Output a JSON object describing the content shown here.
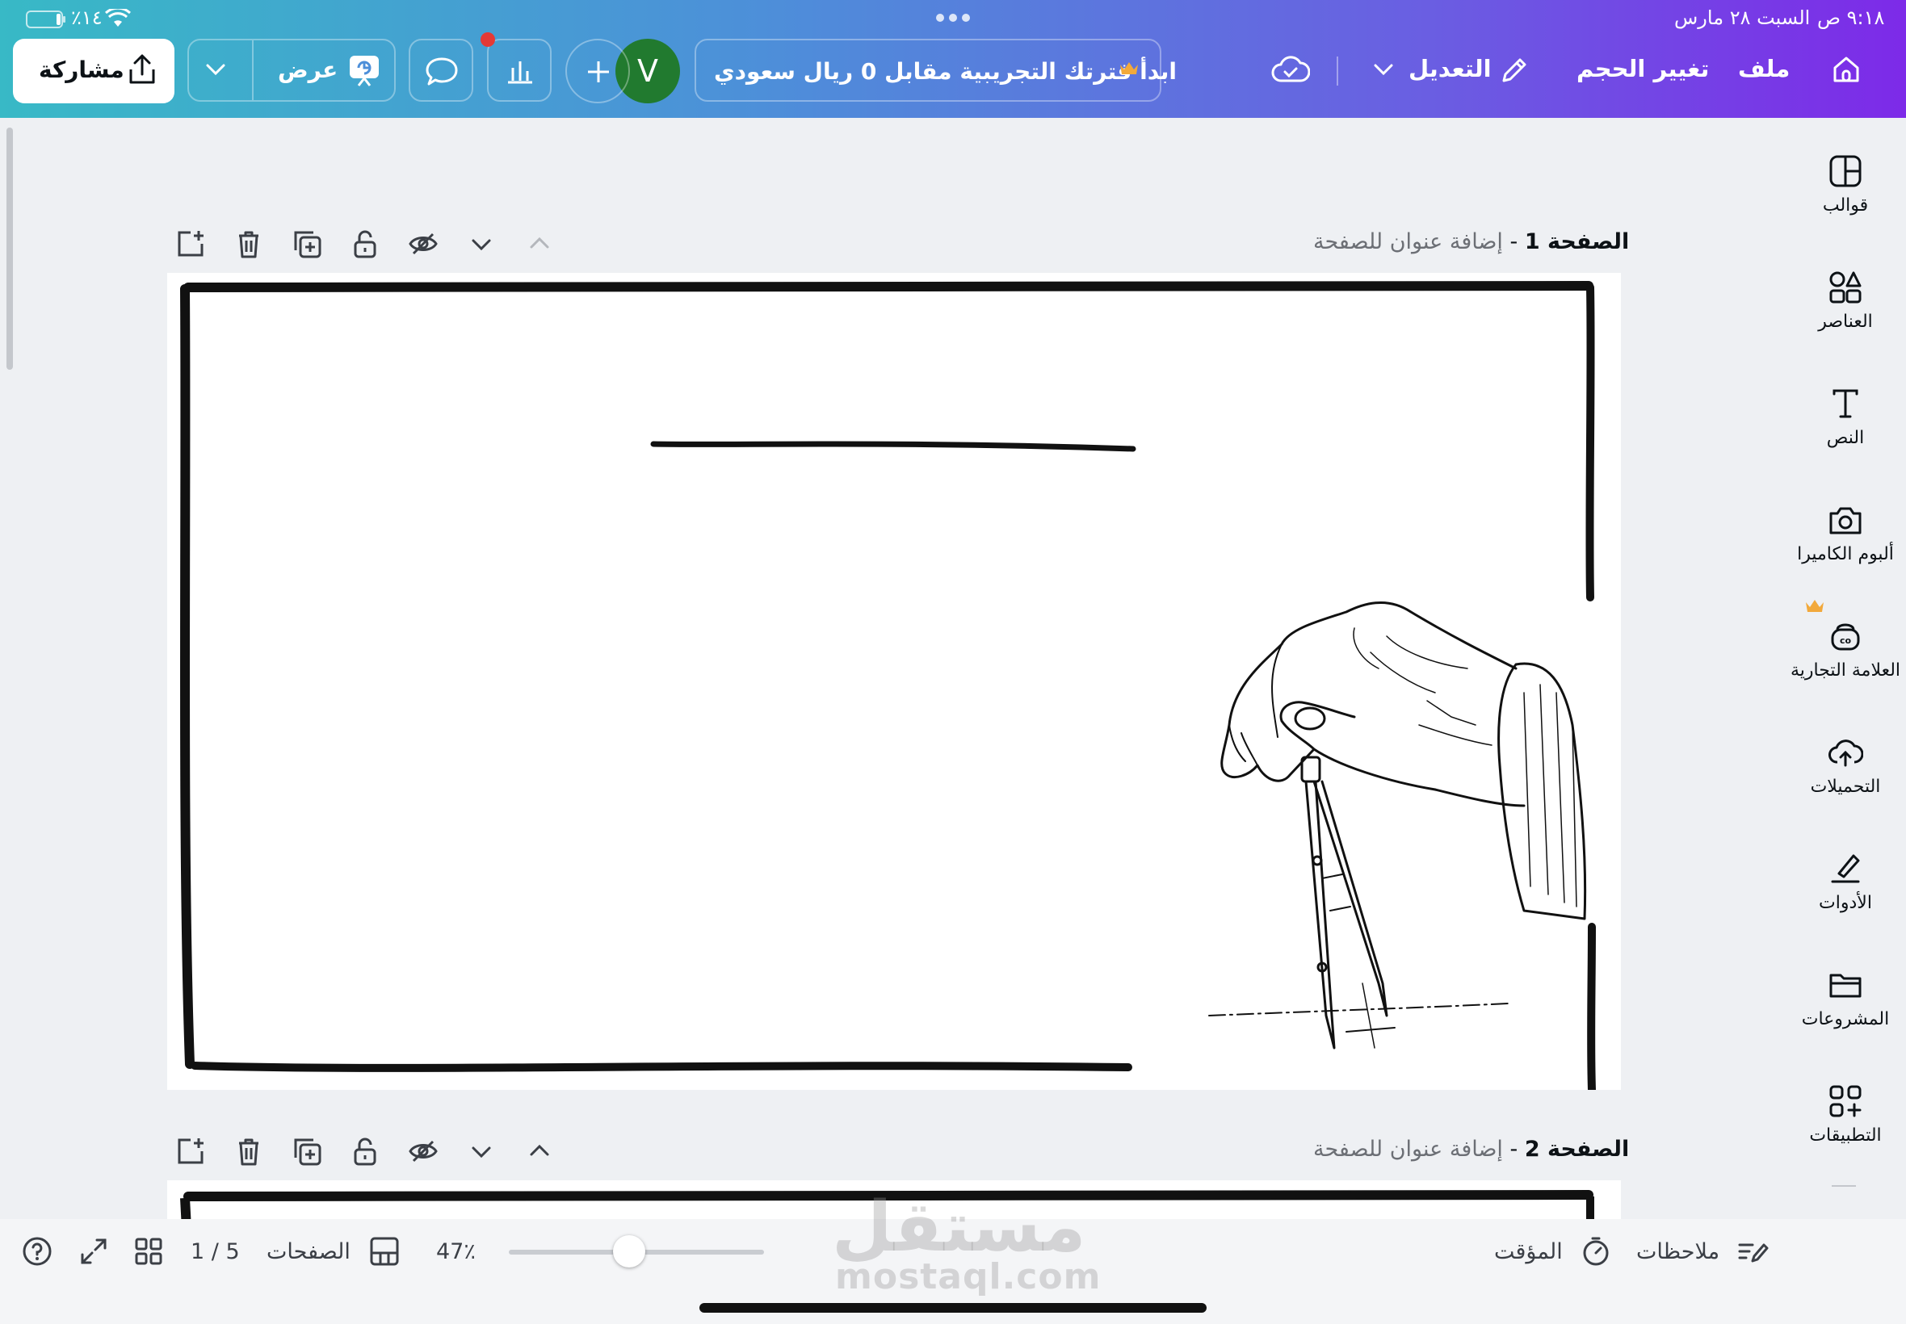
{
  "status_bar": {
    "time": "٩:١٨ ص",
    "date": "السبت ٢٨ مارس",
    "battery": "٪١٤"
  },
  "topbar": {
    "file": "ملف",
    "resize": "تغيير الحجم",
    "edit": "التعديل",
    "trial_banner": "ابدأ فترتك التجريبية مقابل 0 ريال سعودي",
    "avatar_letter": "V",
    "present": "عرض",
    "share": "مشاركة"
  },
  "sidebar": {
    "items": [
      {
        "label": "قوالب",
        "icon": "templates-icon"
      },
      {
        "label": "العناصر",
        "icon": "elements-icon"
      },
      {
        "label": "النص",
        "icon": "text-icon"
      },
      {
        "label": "ألبوم الكاميرا",
        "icon": "camera-icon"
      },
      {
        "label": "العلامة التجارية",
        "icon": "brand-icon"
      },
      {
        "label": "التحميلات",
        "icon": "upload-cloud-icon"
      },
      {
        "label": "الأدوات",
        "icon": "tools-icon"
      },
      {
        "label": "المشروعات",
        "icon": "folder-icon"
      },
      {
        "label": "التطبيقات",
        "icon": "apps-icon"
      }
    ]
  },
  "pages": [
    {
      "label": "الصفحة 1",
      "separator": " - ",
      "placeholder": "إضافة عنوان للصفحة"
    },
    {
      "label": "الصفحة 2",
      "separator": " - ",
      "placeholder": "إضافة عنوان للصفحة"
    }
  ],
  "bottombar": {
    "notes": "ملاحظات",
    "timer": "المؤقت",
    "zoom": "47٪",
    "zoom_fraction": 0.47,
    "pages": "الصفحات",
    "page_count": "1 / 5"
  },
  "watermark": {
    "ar": "مستقل",
    "en": "mostaql.com"
  },
  "colors": {
    "gradient_start": "#38b9c6",
    "gradient_end": "#7d2ae8",
    "avatar": "#217a2f",
    "notification": "#e53935",
    "crown": "#f2a93b"
  }
}
